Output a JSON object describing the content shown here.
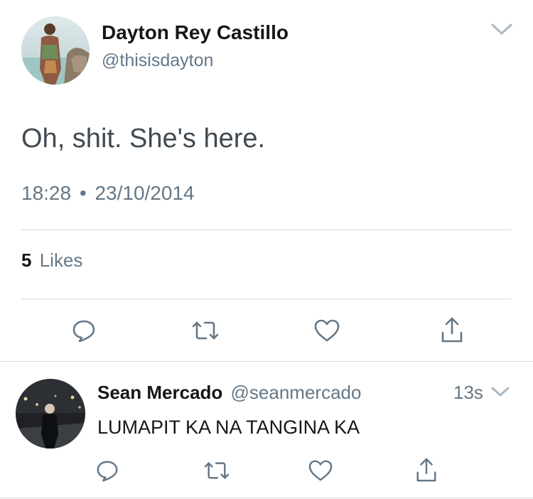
{
  "tweet": {
    "author_name": "Dayton Rey Castillo",
    "author_handle": "@thisisdayton",
    "text": "Oh, shit. She's here.",
    "time": "18:28",
    "separator": "•",
    "date": "23/10/2014",
    "likes_count": "5",
    "likes_label": "Likes"
  },
  "reply": {
    "author_name": "Sean Mercado",
    "author_handle": "@seanmercado",
    "age": "13s",
    "text": "LUMAPIT KA NA TANGINA KA"
  },
  "icons": {
    "chevron": "chevron-down-icon",
    "reply": "reply-icon",
    "retweet": "retweet-icon",
    "like": "heart-icon",
    "share": "share-icon"
  },
  "colors": {
    "text": "#14171a",
    "muted": "#657786",
    "divider": "#d5dbe0",
    "icon": "#657786"
  }
}
